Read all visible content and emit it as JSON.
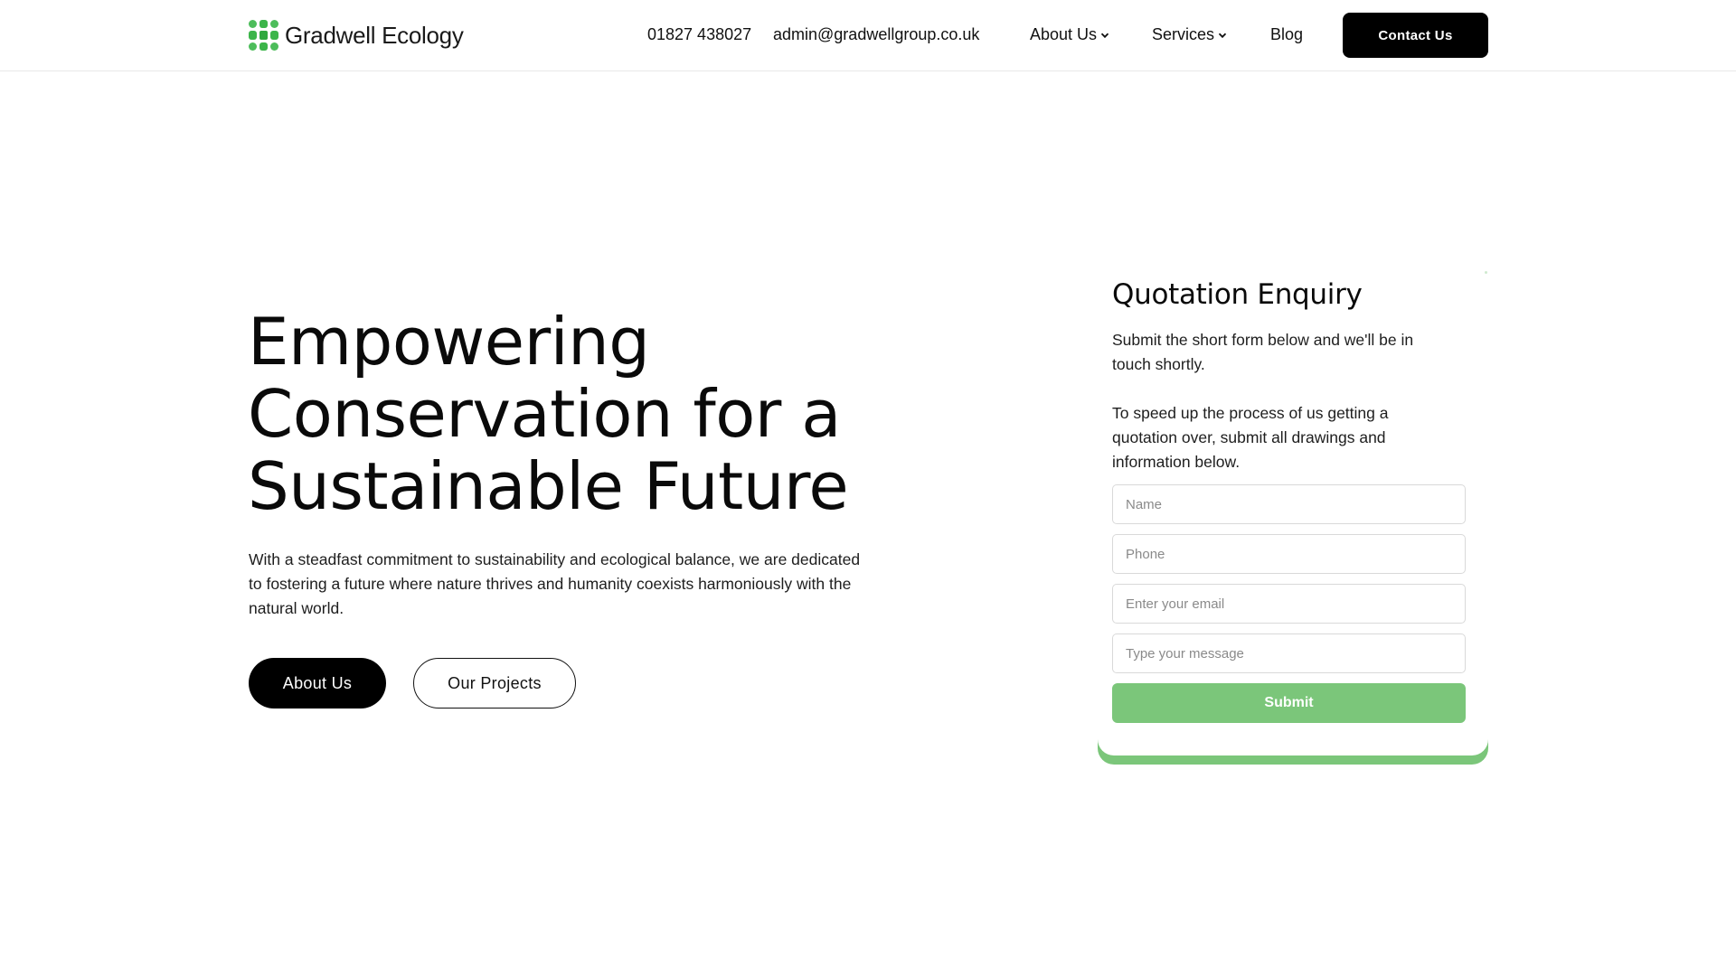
{
  "header": {
    "logo_text": "Gradwell Ecology",
    "phone": "01827 438027",
    "email": "admin@gradwellgroup.co.uk",
    "nav": [
      {
        "label": "About Us",
        "has_dropdown": true
      },
      {
        "label": "Services",
        "has_dropdown": true
      },
      {
        "label": "Blog",
        "has_dropdown": false
      }
    ],
    "contact_button": "Contact Us"
  },
  "hero": {
    "title_lines": [
      "Empowering",
      "Conservation for a",
      "Sustainable Future"
    ],
    "description": "With a steadfast commitment to sustainability and ecological balance, we are dedicated to fostering a future where nature thrives and humanity coexists harmoniously with the natural world.",
    "primary_button": "About Us",
    "secondary_button": "Our Projects"
  },
  "form": {
    "title": "Quotation Enquiry",
    "intro": "Submit the short form below and we'll be in touch shortly.",
    "note": "To speed up the process of us getting a quotation over, submit all drawings and information below.",
    "fields": {
      "name_placeholder": "Name",
      "phone_placeholder": "Phone",
      "email_placeholder": "Enter your email",
      "message_placeholder": "Type your message"
    },
    "submit": "Submit"
  },
  "colors": {
    "accent_green": "#7bc67a",
    "logo_green": "#3cb54a",
    "primary_black": "#000000"
  },
  "icons": {
    "logo": "gradwell-leaf-grid-icon",
    "dropdown": "chevron-down-icon"
  }
}
